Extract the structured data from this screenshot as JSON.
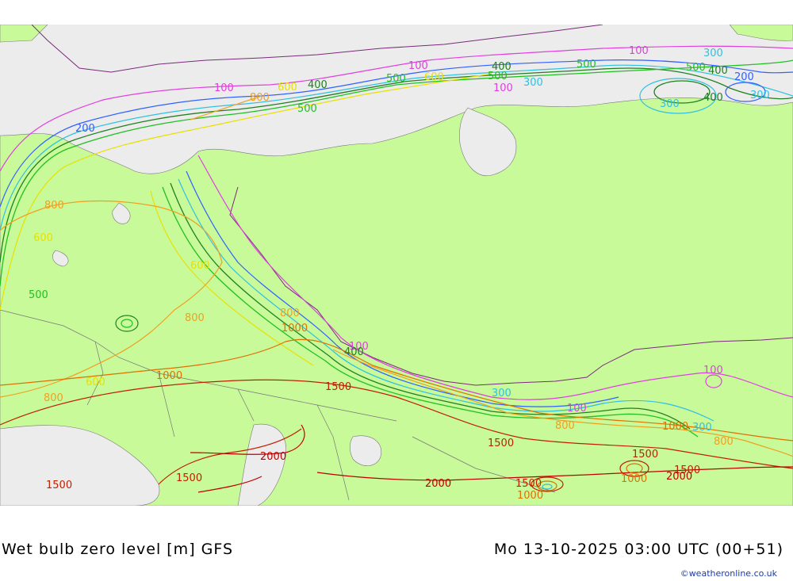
{
  "map": {
    "colors": {
      "land": "#c8fa9a",
      "sea": "#ececec",
      "border": "#5a5a5a",
      "political": "#7a2a7a"
    },
    "levels": [
      {
        "value": "100",
        "color": "#e040e0"
      },
      {
        "value": "200",
        "color": "#3060ff"
      },
      {
        "value": "300",
        "color": "#30c0e0"
      },
      {
        "value": "400",
        "color": "#208020"
      },
      {
        "value": "500",
        "color": "#20c020"
      },
      {
        "value": "600",
        "color": "#e8e000"
      },
      {
        "value": "800",
        "color": "#f0a020"
      },
      {
        "value": "1000",
        "color": "#e07000"
      },
      {
        "value": "1500",
        "color": "#c02000"
      },
      {
        "value": "2000",
        "color": "#c00000"
      }
    ]
  },
  "footer": {
    "title": "Wet bulb zero level [m] GFS",
    "datetime": "Mo 13-10-2025 03:00 UTC (00+51)",
    "credit": "©weatheronline.co.uk"
  }
}
